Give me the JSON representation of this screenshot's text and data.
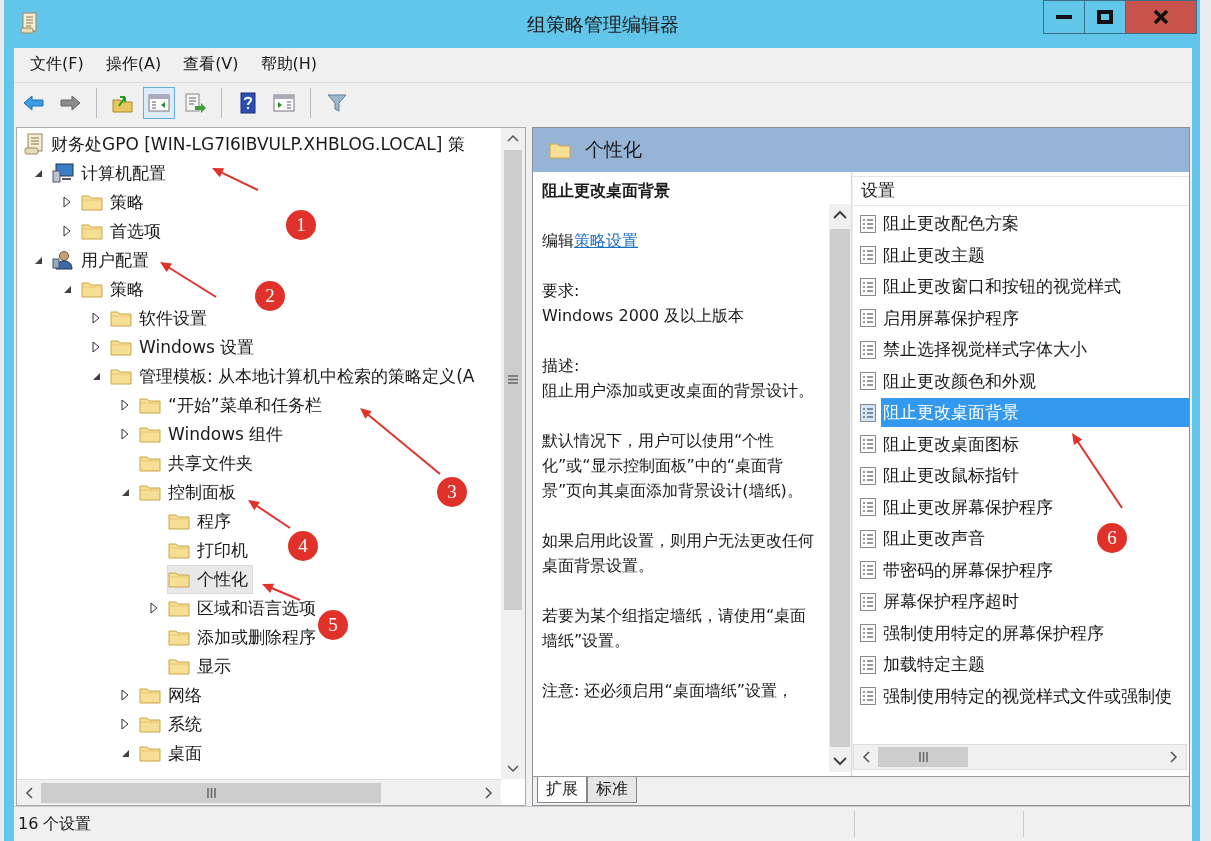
{
  "window": {
    "title": "组策略管理编辑器"
  },
  "menu": [
    "文件(F)",
    "操作(A)",
    "查看(V)",
    "帮助(H)"
  ],
  "toolbar": [
    [
      {
        "kind": "back",
        "pressed": false
      },
      {
        "kind": "forward",
        "pressed": false
      }
    ],
    [
      {
        "kind": "up-folder",
        "pressed": false
      },
      {
        "kind": "console-tree",
        "pressed": true
      },
      {
        "kind": "export",
        "pressed": false
      }
    ],
    [
      {
        "kind": "help",
        "pressed": false
      },
      {
        "kind": "action-pane",
        "pressed": false
      }
    ],
    [
      {
        "kind": "filter",
        "pressed": false
      }
    ]
  ],
  "tree": [
    {
      "label": "财务处GPO [WIN-LG7I6IBVULP.XHBLOG.LOCAL] 策",
      "kind": "gpo",
      "selected": false,
      "children": [
        {
          "label": "计算机配置",
          "kind": "computer",
          "selected": false,
          "expanded": true,
          "children": [
            {
              "label": "策略",
              "kind": "folder",
              "selected": false,
              "expanded": false
            },
            {
              "label": "首选项",
              "kind": "folder",
              "selected": false,
              "expanded": false
            }
          ]
        },
        {
          "label": "用户配置",
          "kind": "user",
          "selected": false,
          "expanded": true,
          "children": [
            {
              "label": "策略",
              "kind": "folder",
              "selected": false,
              "expanded": true,
              "children": [
                {
                  "label": "软件设置",
                  "kind": "folder",
                  "selected": false,
                  "expanded": false
                },
                {
                  "label": "Windows 设置",
                  "kind": "folder",
                  "selected": false,
                  "expanded": false
                },
                {
                  "label": "管理模板: 从本地计算机中检索的策略定义(A",
                  "kind": "folder",
                  "selected": false,
                  "expanded": true,
                  "children": [
                    {
                      "label": "“开始”菜单和任务栏",
                      "kind": "folder",
                      "selected": false,
                      "expanded": false
                    },
                    {
                      "label": "Windows 组件",
                      "kind": "folder",
                      "selected": false,
                      "expanded": false
                    },
                    {
                      "label": "共享文件夹",
                      "kind": "folder",
                      "selected": false
                    },
                    {
                      "label": "控制面板",
                      "kind": "folder",
                      "selected": false,
                      "expanded": true,
                      "children": [
                        {
                          "label": "程序",
                          "kind": "folder",
                          "selected": false
                        },
                        {
                          "label": "打印机",
                          "kind": "folder",
                          "selected": false
                        },
                        {
                          "label": "个性化",
                          "kind": "folder",
                          "selected": true
                        },
                        {
                          "label": "区域和语言选项",
                          "kind": "folder",
                          "selected": false,
                          "expanded": false
                        },
                        {
                          "label": "添加或删除程序",
                          "kind": "folder",
                          "selected": false
                        },
                        {
                          "label": "显示",
                          "kind": "folder",
                          "selected": false
                        }
                      ]
                    },
                    {
                      "label": "网络",
                      "kind": "folder",
                      "selected": false,
                      "expanded": false
                    },
                    {
                      "label": "系统",
                      "kind": "folder",
                      "selected": false,
                      "expanded": false
                    },
                    {
                      "label": "桌面",
                      "kind": "folder",
                      "selected": false,
                      "expanded": true
                    }
                  ]
                }
              ]
            }
          ]
        }
      ]
    }
  ],
  "details": {
    "header": "个性化",
    "title": "阻止更改桌面背景",
    "edit_prefix": "编辑",
    "edit_link": "策略设置",
    "requirements_label": "要求:",
    "requirements": "Windows 2000 及以上版本",
    "description_label": "描述:",
    "paragraphs": [
      "阻止用户添加或更改桌面的背景设计。",
      "默认情况下，用户可以使用“个性化”或“显示控制面板”中的“桌面背景”页向其桌面添加背景设计(墙纸)。",
      "如果启用此设置，则用户无法更改任何桌面背景设置。",
      "若要为某个组指定墙纸，请使用“桌面墙纸”设置。",
      "注意: 还必须启用“桌面墙纸”设置，"
    ]
  },
  "settings": {
    "column": "设置",
    "items": [
      {
        "label": "阻止更改配色方案",
        "selected": false
      },
      {
        "label": "阻止更改主题",
        "selected": false
      },
      {
        "label": "阻止更改窗口和按钮的视觉样式",
        "selected": false
      },
      {
        "label": "启用屏幕保护程序",
        "selected": false
      },
      {
        "label": "禁止选择视觉样式字体大小",
        "selected": false
      },
      {
        "label": "阻止更改颜色和外观",
        "selected": false
      },
      {
        "label": "阻止更改桌面背景",
        "selected": true
      },
      {
        "label": "阻止更改桌面图标",
        "selected": false
      },
      {
        "label": "阻止更改鼠标指针",
        "selected": false
      },
      {
        "label": "阻止更改屏幕保护程序",
        "selected": false
      },
      {
        "label": "阻止更改声音",
        "selected": false
      },
      {
        "label": "带密码的屏幕保护程序",
        "selected": false
      },
      {
        "label": "屏幕保护程序超时",
        "selected": false
      },
      {
        "label": "强制使用特定的屏幕保护程序",
        "selected": false
      },
      {
        "label": "加载特定主题",
        "selected": false
      },
      {
        "label": "强制使用特定的视觉样式文件或强制使",
        "selected": false
      }
    ]
  },
  "tabs": [
    {
      "label": "扩展",
      "selected": true
    },
    {
      "label": "标准",
      "selected": false
    }
  ],
  "status_bar": {
    "text": "16 个设置"
  },
  "annotations": [
    {
      "number": "1"
    },
    {
      "number": "2"
    },
    {
      "number": "3"
    },
    {
      "number": "4"
    },
    {
      "number": "5"
    },
    {
      "number": "6"
    }
  ]
}
